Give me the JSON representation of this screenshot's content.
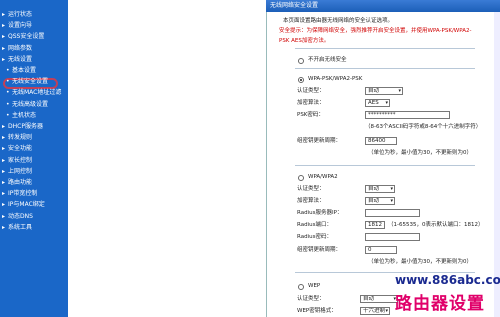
{
  "sidebar": {
    "items": [
      {
        "label": "运行状态",
        "sub": false
      },
      {
        "label": "设置向导",
        "sub": false
      },
      {
        "label": "QSS安全设置",
        "sub": false
      },
      {
        "label": "网络参数",
        "sub": false
      },
      {
        "label": "无线设置",
        "sub": false
      },
      {
        "label": "基本设置",
        "sub": true
      },
      {
        "label": "无线安全设置",
        "sub": true,
        "selected": true
      },
      {
        "label": "无线MAC地址过滤",
        "sub": true
      },
      {
        "label": "无线高级设置",
        "sub": true
      },
      {
        "label": "主机状态",
        "sub": true
      },
      {
        "label": "DHCP服务器",
        "sub": false
      },
      {
        "label": "转发规则",
        "sub": false
      },
      {
        "label": "安全功能",
        "sub": false
      },
      {
        "label": "家长控制",
        "sub": false
      },
      {
        "label": "上网控制",
        "sub": false
      },
      {
        "label": "路由功能",
        "sub": false
      },
      {
        "label": "IP带宽控制",
        "sub": false
      },
      {
        "label": "IP与MAC绑定",
        "sub": false
      },
      {
        "label": "动态DNS",
        "sub": false
      },
      {
        "label": "系统工具",
        "sub": false
      }
    ]
  },
  "panel": {
    "title": "无线网络安全设置",
    "intro": "本页面设置路由器无线网络的安全认证选项。",
    "warning_line1": "安全提示：为保障网络安全，强烈推荐开启安全设置，并使用WPA-PSK/WPA2-",
    "warning_line2": "PSK AES加密方法。",
    "off_option": "不开启无线安全",
    "psk_option": "WPA-PSK/WPA2-PSK",
    "psk": {
      "auth_label": "认证类型：",
      "auth_value": "自动",
      "enc_label": "加密算法：",
      "enc_value": "AES",
      "pwd_label": "PSK密码：",
      "pwd_value": "**********",
      "pwd_hint": "（8-63个ASCII码字符或8-64个十六进制字符）",
      "period_label": "组密钥更新周期：",
      "period_value": "86400",
      "period_hint": "（单位为秒，最小值为30，不更新则为0）"
    },
    "wpa_option": "WPA/WPA2",
    "wpa": {
      "auth_label": "认证类型：",
      "auth_value": "自动",
      "enc_label": "加密算法：",
      "enc_value": "自动",
      "ip_label": "Radius服务器IP：",
      "ip_value": "",
      "port_label": "Radius端口：",
      "port_value": "1812",
      "port_hint": "（1-65535，0表示默认端口：1812）",
      "pwd_label": "Radius密码：",
      "pwd_value": "",
      "period_label": "组密钥更新周期：",
      "period_value": "0",
      "period_hint": "（单位为秒，最小值为30，不更新则为0）"
    },
    "wep_option": "WEP",
    "wep": {
      "auth_label": "认证类型：",
      "auth_value": "自动",
      "fmt_label": "WEP密钥格式：",
      "fmt_value": "十六进制"
    }
  },
  "watermark": {
    "url": "www.886abc.com",
    "brand": "路由器设置"
  },
  "colors": {
    "sidebar": "#1a67c8",
    "titlebar": "#1c5fb8",
    "warning": "#d00000",
    "brand": "#e0006a"
  }
}
